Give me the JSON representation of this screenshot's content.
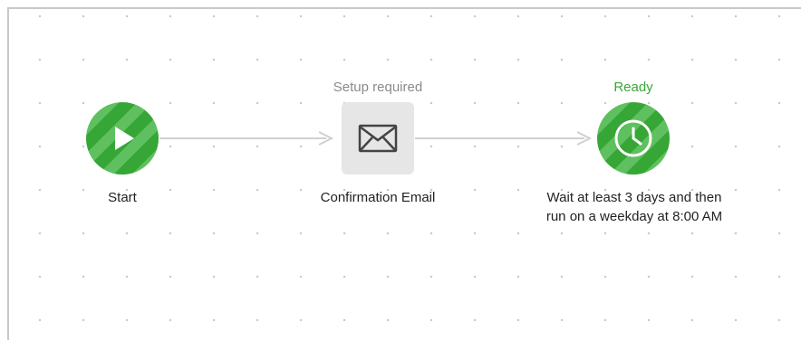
{
  "nodes": [
    {
      "id": "start",
      "label": "Start",
      "status": "",
      "icon": "play-icon"
    },
    {
      "id": "email",
      "label": "Confirmation Email",
      "status": "Setup required",
      "icon": "envelope-icon"
    },
    {
      "id": "wait",
      "label": "Wait at least 3 days and then run on a weekday at 8:00 AM",
      "status": "Ready",
      "icon": "clock-icon"
    }
  ],
  "colors": {
    "green_dark": "#36a636",
    "green_light": "#5fc05f",
    "status_setup": "#8a8a8a",
    "status_ready": "#3aa53a",
    "connector": "#d0d0d0",
    "email_bg": "#e6e6e6"
  }
}
